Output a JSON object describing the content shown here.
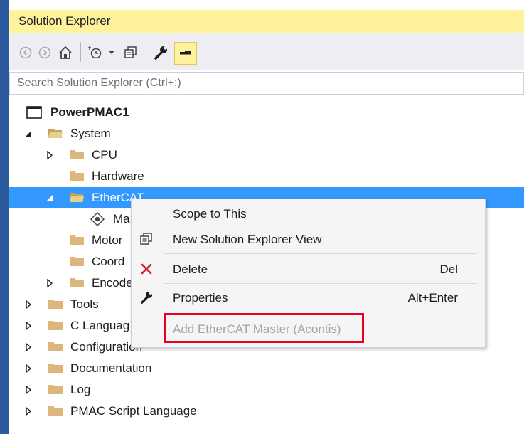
{
  "panel": {
    "title": "Solution Explorer"
  },
  "toolbar": {
    "icons": [
      "back-icon",
      "forward-icon",
      "home-icon",
      "history-icon",
      "dropdown-icon",
      "sync-icon",
      "properties-icon",
      "preview-icon"
    ]
  },
  "search": {
    "placeholder": "Search Solution Explorer (Ctrl+:)",
    "value": ""
  },
  "tree": {
    "root": "PowerPMAC1",
    "items": [
      "System",
      "CPU",
      "Hardware",
      "EtherCAT",
      "Ma",
      "Motor",
      "Coord",
      "Encode",
      "Tools",
      "C Languag",
      "Configuration",
      "Documentation",
      "Log",
      "PMAC Script Language"
    ]
  },
  "context_menu": {
    "items": [
      {
        "label": "Scope to This",
        "shortcut": ""
      },
      {
        "label": "New Solution Explorer View",
        "shortcut": ""
      },
      {
        "label": "Delete",
        "shortcut": "Del"
      },
      {
        "label": "Properties",
        "shortcut": "Alt+Enter"
      },
      {
        "label": "Add EtherCAT Master (Acontis)",
        "shortcut": "",
        "disabled": true
      }
    ]
  },
  "colors": {
    "title_bar": "#fff29d",
    "selection": "#3399ff",
    "folder": "#dcb67a",
    "highlight_border": "#e8001c",
    "frame": "#2d5a9c"
  }
}
